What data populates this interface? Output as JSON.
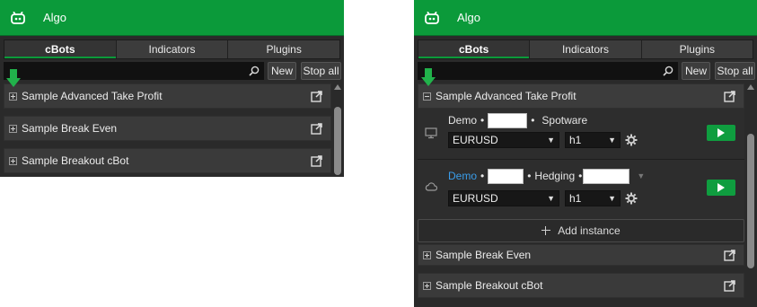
{
  "header": {
    "title": "Algo",
    "icon": "robot-icon"
  },
  "tabs": [
    {
      "label": "cBots",
      "active": true
    },
    {
      "label": "Indicators",
      "active": false
    },
    {
      "label": "Plugins",
      "active": false
    }
  ],
  "toolbar": {
    "search_value": "",
    "new_label": "New",
    "stop_all_label": "Stop all"
  },
  "left_panel": {
    "items": [
      {
        "label": "Sample Advanced Take Profit",
        "expanded": false
      },
      {
        "label": "Sample Break Even",
        "expanded": false
      },
      {
        "label": "Sample Breakout cBot",
        "expanded": false
      }
    ]
  },
  "right_panel": {
    "expanded_item": {
      "label": "Sample Advanced Take Profit",
      "expanded": true
    },
    "instances": [
      {
        "icon": "monitor-icon",
        "account_type": "Demo",
        "account_type_is_link": false,
        "bullet": "•",
        "broker": "Spotware",
        "symbol": "EURUSD",
        "timeframe": "h1"
      },
      {
        "icon": "cloud-icon",
        "account_type": "Demo",
        "account_type_is_link": true,
        "bullet": "•",
        "mode": "Hedging",
        "symbol": "EURUSD",
        "timeframe": "h1"
      }
    ],
    "add_instance_label": "Add instance",
    "items": [
      {
        "label": "Sample Break Even",
        "expanded": false
      },
      {
        "label": "Sample Breakout cBot",
        "expanded": false
      }
    ]
  },
  "colors": {
    "accent_green": "#0b9a3a",
    "link_blue": "#3a9dea",
    "panel_bg": "#2a2a2a"
  }
}
